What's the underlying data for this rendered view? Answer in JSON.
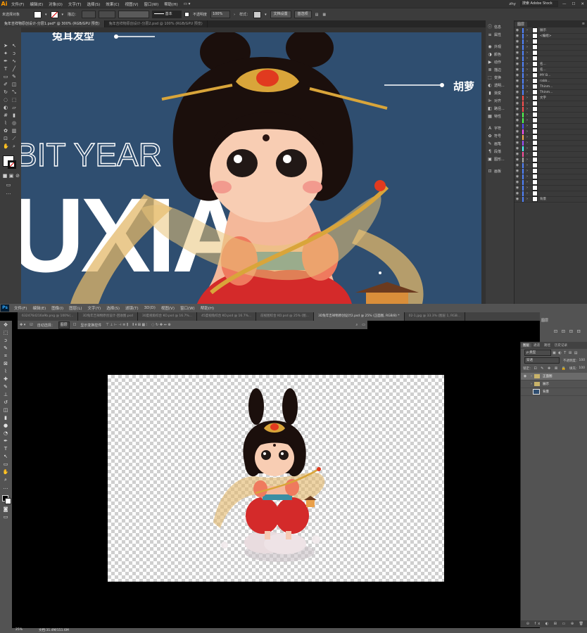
{
  "illustrator": {
    "app_logo": "Ai",
    "menu": [
      "文件(F)",
      "编辑(E)",
      "对象(O)",
      "文字(T)",
      "选择(S)",
      "效果(C)",
      "视图(V)",
      "窗口(W)",
      "帮助(H)"
    ],
    "user": "zhy",
    "search_placeholder": "搜索 Adobe Stock",
    "control_bar": {
      "selection_label": "未选择对象",
      "stroke_label": "描边：",
      "stroke_style": "基本",
      "opacity_label": "不透明度",
      "opacity_value": "100%",
      "style_label": "样式：",
      "doc_setup_button": "文档设置",
      "preferences_button": "首选项"
    },
    "tabs": [
      {
        "label": "兔年吉祥物原创设计-分层1.psd* @ 300% (RGB/GPU 预览)",
        "active": true
      },
      {
        "label": "兔年吉祥物原创设计-分层2.psd @ 100% (RGB/GPU 预览)",
        "active": false
      }
    ],
    "artboard": {
      "label_top": "兔耳发型",
      "label_right": "胡萝",
      "outline_text": "BIT YEAR",
      "big_text": "UXIA",
      "background": "#2f4e70"
    },
    "dock": [
      "信息",
      "属性",
      "外观",
      "颜色",
      "动作",
      "描边",
      "变换",
      "透明...",
      "渐变",
      "对齐",
      "路径...",
      "特性",
      "字符",
      "符号",
      "画笔",
      "段落",
      "图形...",
      "画板"
    ],
    "layers": {
      "tab_label": "图层",
      "items": [
        {
          "name": "展示",
          "color": "#4f82ff"
        },
        {
          "name": "<编组>",
          "color": "#4f82ff"
        },
        {
          "name": "",
          "color": "#4f82ff"
        },
        {
          "name": "",
          "color": "#4f82ff"
        },
        {
          "name": "",
          "color": "#4f82ff"
        },
        {
          "name": "",
          "color": "#4f82ff"
        },
        {
          "name": "名...",
          "color": "#4f82ff"
        },
        {
          "name": "名...",
          "color": "#4f82ff"
        },
        {
          "name": "MY B...",
          "color": "#4f82ff"
        },
        {
          "name": "rabb...",
          "color": "#4f82ff"
        },
        {
          "name": "Thinm...",
          "color": "#4f82ff"
        },
        {
          "name": "Thinm...",
          "color": "#4f82ff"
        },
        {
          "name": "文字",
          "color": "#ff4f4f"
        },
        {
          "name": "",
          "color": "#ff4f4f"
        },
        {
          "name": "",
          "color": "#ff4f4f"
        },
        {
          "name": "",
          "color": "#4fff4f"
        },
        {
          "name": "",
          "color": "#4fff4f"
        },
        {
          "name": "",
          "color": "#4f4fff"
        },
        {
          "name": "",
          "color": "#ff4fff"
        },
        {
          "name": "",
          "color": "#ffb04f"
        },
        {
          "name": "",
          "color": "#9f4fff"
        },
        {
          "name": "",
          "color": "#4fffff"
        },
        {
          "name": "",
          "color": "#ff4f9f"
        },
        {
          "name": "",
          "color": "#aaaaaa"
        },
        {
          "name": "",
          "color": "#4f82ff"
        },
        {
          "name": "",
          "color": "#4f82ff"
        },
        {
          "name": "",
          "color": "#4f82ff"
        },
        {
          "name": "",
          "color": "#4f82ff"
        },
        {
          "name": "",
          "color": "#4f82ff"
        },
        {
          "name": "",
          "color": "#4f82ff"
        },
        {
          "name": "背景",
          "color": "#4f82ff"
        }
      ]
    }
  },
  "photoshop": {
    "app_logo": "Ps",
    "menu": [
      "文件(F)",
      "编辑(E)",
      "图像(I)",
      "图层(L)",
      "文字(Y)",
      "选择(S)",
      "滤镜(T)",
      "3D(D)",
      "视图(V)",
      "窗口(W)",
      "帮助(H)"
    ],
    "tabs": [
      {
        "label": "632476d216a9b.png @ 100%(...",
        "active": false
      },
      {
        "label": "3D兔年吉祥物原创设计-回收图.psd",
        "active": false
      },
      {
        "label": "30度视角综合 KO.psd @ 16.7%...",
        "active": false
      },
      {
        "label": "45度视角综合 KO.psd @ 16.7%...",
        "active": false
      },
      {
        "label": "前视图综合 KO.psd @ 25% (图...",
        "active": false
      },
      {
        "label": "3D兔年吉祥物原创设计2.psd @ 25% (正面图, RGB/8) *",
        "active": true
      },
      {
        "label": "02-1.jpg @ 33.3% (图层 1, RGB...",
        "active": false
      }
    ],
    "options": {
      "auto_select": "自动选择：",
      "layer_dropdown": "图层",
      "show_transform": "显示变换控件"
    },
    "right_panel_tab": "图层",
    "layers_panel": {
      "tabs": [
        "图层",
        "通道",
        "路径",
        "历史记录"
      ],
      "kind_label": "ρ 类型",
      "blend_mode": "穿透",
      "opacity_label": "不透明度：",
      "opacity_value": "100",
      "lock_label": "锁定：",
      "fill_label": "填充：",
      "fill_value": "100",
      "items": [
        {
          "name": "正面图",
          "type": "group",
          "visible": true,
          "selected": true
        },
        {
          "name": "展示",
          "type": "group",
          "visible": false,
          "selected": false
        },
        {
          "name": "背景",
          "type": "fill",
          "visible": false,
          "selected": false
        }
      ]
    },
    "status": {
      "zoom": "25%",
      "doc": "文档:31.4M/151.6M"
    }
  },
  "colors": {
    "ai_bg": "#323232",
    "ai_artboard": "#2f4e70",
    "ps_bg": "#535353",
    "character_dress": "#d42a2a",
    "character_hair": "#1b0f0c",
    "ribbon_gold": "#d9a53a"
  }
}
